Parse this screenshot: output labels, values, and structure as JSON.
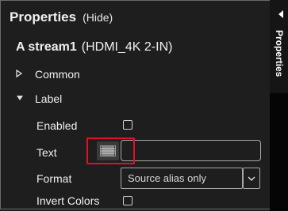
{
  "header": {
    "title": "Properties",
    "hide_label": "(Hide)"
  },
  "stream": {
    "name": "A stream1",
    "device": "(HDMI_4K 2-IN)"
  },
  "sections": {
    "common": "Common",
    "label": "Label"
  },
  "rows": {
    "enabled": {
      "label": "Enabled",
      "checked": false
    },
    "text": {
      "label": "Text",
      "value": ""
    },
    "format": {
      "label": "Format",
      "selected": "Source alias only"
    },
    "invert": {
      "label": "Invert Colors",
      "checked": false
    }
  },
  "side_tab": {
    "label": "Properties"
  },
  "colors": {
    "background": "#1e1e1e",
    "highlight": "#e0102a",
    "text": "#f0f0f0"
  },
  "icons": {
    "collapse": "triangle-right-icon",
    "expand": "triangle-down-icon",
    "grid": "character-grid-icon",
    "dropdown": "chevron-down-icon",
    "panel": "caret-left-icon"
  }
}
